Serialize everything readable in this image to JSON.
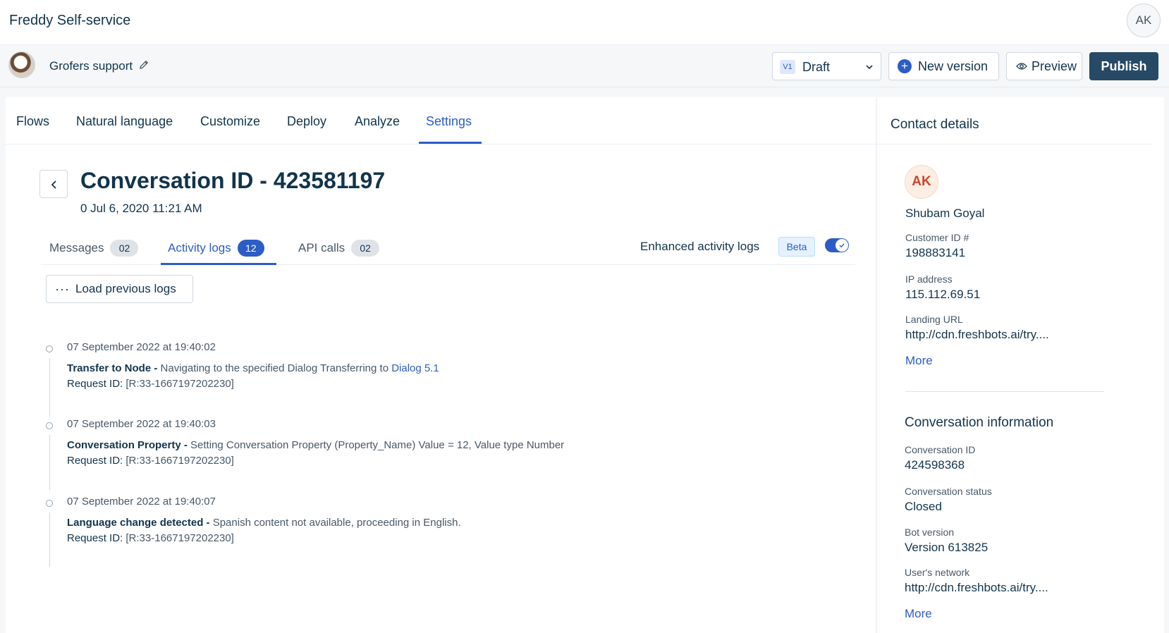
{
  "app": {
    "title": "Freddy Self-service",
    "user_initials": "AK"
  },
  "bot": {
    "name": "Grofers support"
  },
  "version": {
    "badge": "V1",
    "label": "Draft"
  },
  "actions": {
    "new_version": "New version",
    "preview": "Preview",
    "publish": "Publish"
  },
  "nav": {
    "tabs": [
      "Flows",
      "Natural language",
      "Customize",
      "Deploy",
      "Analyze",
      "Settings"
    ],
    "active": "Settings"
  },
  "conversation": {
    "title": "Conversation ID - 423581197",
    "date": "0 Jul 6, 2020 11:21 AM"
  },
  "sub_tabs": [
    {
      "label": "Messages",
      "count": "02"
    },
    {
      "label": "Activity logs",
      "count": "12"
    },
    {
      "label": "API calls",
      "count": "02"
    }
  ],
  "enhanced": {
    "label": "Enhanced activity logs",
    "badge": "Beta",
    "enabled": true
  },
  "load_previous": "Load previous logs",
  "logs": [
    {
      "time": "07 September 2022 at 19:40:02",
      "title": "Transfer to Node -",
      "text": " Navigating to the specified Dialog Transferring to ",
      "link": "Dialog 5.1",
      "req_label": "Request ID:",
      "req_value": " [R:33-1667197202230]"
    },
    {
      "time": "07 September 2022 at 19:40:03",
      "title": "Conversation Property - ",
      "text": " Setting Conversation Property (Property_Name) Value = 12, Value type Number",
      "link": "",
      "req_label": "Request ID:",
      "req_value": " [R:33-1667197202230]"
    },
    {
      "time": "07 September 2022 at 19:40:07",
      "title": "Language change detected -",
      "text": " Spanish content not available, proceeding in English.",
      "link": "",
      "req_label": "Request ID:",
      "req_value": " [R:33-1667197202230]"
    }
  ],
  "contact": {
    "section_title": "Contact details",
    "initials": "AK",
    "name": "Shubam Goyal",
    "fields": [
      {
        "label": "Customer ID #",
        "value": "198883141"
      },
      {
        "label": "IP address",
        "value": "115.112.69.51"
      },
      {
        "label": "Landing URL",
        "value": "http://cdn.freshbots.ai/try...."
      }
    ],
    "more": "More"
  },
  "conversation_info": {
    "section_title": "Conversation information",
    "fields": [
      {
        "label": "Conversation ID",
        "value": "424598368"
      },
      {
        "label": "Conversation status",
        "value": "Closed"
      },
      {
        "label": "Bot version",
        "value": "Version 613825"
      },
      {
        "label": "User's network",
        "value": "http://cdn.freshbots.ai/try...."
      }
    ],
    "more": "More"
  },
  "colors": {
    "primary": "#2c5cc5",
    "publish": "#264966",
    "text": "#12344d",
    "muted": "#475867"
  }
}
